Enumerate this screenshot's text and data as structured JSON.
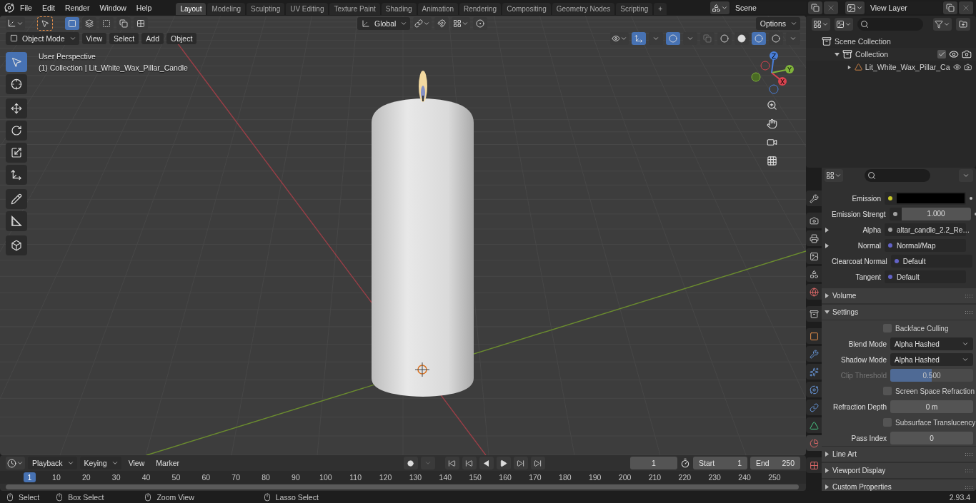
{
  "menu": [
    "File",
    "Edit",
    "Render",
    "Window",
    "Help"
  ],
  "workspaces": [
    {
      "label": "Layout",
      "selected": true
    },
    {
      "label": "Modeling",
      "selected": false
    },
    {
      "label": "Sculpting",
      "selected": false
    },
    {
      "label": "UV Editing",
      "selected": false
    },
    {
      "label": "Texture Paint",
      "selected": false
    },
    {
      "label": "Shading",
      "selected": false
    },
    {
      "label": "Animation",
      "selected": false
    },
    {
      "label": "Rendering",
      "selected": false
    },
    {
      "label": "Compositing",
      "selected": false
    },
    {
      "label": "Geometry Nodes",
      "selected": false
    },
    {
      "label": "Scripting",
      "selected": false
    }
  ],
  "add_workspace": "+",
  "scene": "Scene",
  "view_layer": "View Layer",
  "tool_header": {
    "select_modes": [
      {
        "selected": true
      },
      {
        "selected": false
      },
      {
        "selected": false
      },
      {
        "selected": false
      },
      {
        "selected": false
      }
    ],
    "orientation": "Global",
    "options": "Options"
  },
  "viewport_header": {
    "mode": "Object Mode",
    "menus": [
      "View",
      "Select",
      "Add",
      "Object"
    ],
    "shading": [
      {
        "selected": false
      },
      {
        "selected": false
      },
      {
        "selected": true
      },
      {
        "selected": false
      }
    ]
  },
  "toolbar": [
    {
      "kind": "select",
      "selected": true
    },
    {
      "kind": "cursor",
      "selected": false
    },
    {
      "kind": "move",
      "selected": false
    },
    {
      "kind": "rotate",
      "selected": false
    },
    {
      "kind": "scale",
      "selected": false
    },
    {
      "kind": "transform",
      "selected": false
    },
    {
      "kind": "annotate",
      "selected": false
    },
    {
      "kind": "measure",
      "selected": false
    },
    {
      "kind": "add_cube",
      "selected": false
    }
  ],
  "viewport": {
    "view_name": "User Perspective",
    "collection_info": "(1) Collection | Lit_White_Wax_Pillar_Candle",
    "gizmo_axes": [
      "X",
      "Y",
      "Z"
    ]
  },
  "outliner": {
    "items": [
      {
        "label": "Scene Collection",
        "kind": "scene",
        "children": [
          {
            "label": "Collection",
            "kind": "collection",
            "expanded": true,
            "checked": true,
            "children": [
              {
                "label": "Lit_White_Wax_Pillar_Ca",
                "kind": "object",
                "expanded": false
              }
            ]
          }
        ]
      }
    ]
  },
  "properties": {
    "tabs": [
      {
        "kind": "tool",
        "selected": false
      },
      {
        "kind": "render",
        "selected": false
      },
      {
        "kind": "output",
        "selected": false
      },
      {
        "kind": "view_layer",
        "selected": false
      },
      {
        "kind": "scene",
        "selected": false
      },
      {
        "kind": "world",
        "selected": false
      },
      {
        "kind": "collection",
        "selected": false
      },
      {
        "kind": "object",
        "selected": false
      },
      {
        "kind": "modifier",
        "selected": false
      },
      {
        "kind": "particles",
        "selected": false
      },
      {
        "kind": "physics",
        "selected": false
      },
      {
        "kind": "constraints",
        "selected": false
      },
      {
        "kind": "data",
        "selected": false
      },
      {
        "kind": "material",
        "selected": true
      },
      {
        "kind": "texture",
        "selected": false
      }
    ],
    "sockets": [
      {
        "kind": "color",
        "label": "Emission",
        "color": "#c7c729",
        "expandable": false,
        "keyframe_dot": true
      },
      {
        "kind": "number",
        "label": "Emission Strengt",
        "value": "1.000",
        "color": "#a1a1a1",
        "expandable": false,
        "keyframe_dot": true
      },
      {
        "kind": "link",
        "label": "Alpha",
        "value": "altar_candle_2.2_Re…",
        "color": "#a1a1a1",
        "expandable": true,
        "keyframe_dot": false
      },
      {
        "kind": "link",
        "label": "Normal",
        "value": "Normal/Map",
        "color": "#6363c7",
        "expandable": true,
        "keyframe_dot": false
      },
      {
        "kind": "link",
        "label": "Clearcoat Normal",
        "value": "Default",
        "color": "#6363c7",
        "expandable": false,
        "keyframe_dot": false
      },
      {
        "kind": "link",
        "label": "Tangent",
        "value": "Default",
        "color": "#6363c7",
        "expandable": false,
        "keyframe_dot": false
      }
    ],
    "panels_before": [
      {
        "label": "Volume",
        "expanded": false
      }
    ],
    "settings": {
      "label": "Settings",
      "expanded": true,
      "rows": [
        {
          "kind": "checkbox",
          "label": "Backface Culling",
          "checked": false
        },
        {
          "kind": "dropdown",
          "label": "Blend Mode",
          "value": "Alpha Hashed"
        },
        {
          "kind": "dropdown",
          "label": "Shadow Mode",
          "value": "Alpha Hashed"
        },
        {
          "kind": "slider",
          "label": "Clip Threshold",
          "value": "0.500",
          "level": 0.5,
          "disabled": true
        },
        {
          "kind": "checkbox",
          "label": "Screen Space Refraction",
          "checked": false
        },
        {
          "kind": "number",
          "label": "Refraction Depth",
          "value": "0 m"
        },
        {
          "kind": "checkbox",
          "label": "Subsurface Translucency",
          "checked": false
        },
        {
          "kind": "number",
          "label": "Pass Index",
          "value": "0"
        }
      ]
    },
    "panels_after": [
      {
        "label": "Line Art",
        "expanded": false
      },
      {
        "label": "Viewport Display",
        "expanded": false
      },
      {
        "label": "Custom Properties",
        "expanded": false
      }
    ]
  },
  "timeline": {
    "menus": [
      "Playback",
      "Keying",
      "View",
      "Marker"
    ],
    "current_frame": "1",
    "start_label": "Start",
    "start": "1",
    "end_label": "End",
    "end": "250",
    "ruler_current": "1",
    "ticks": [
      "10",
      "20",
      "30",
      "40",
      "50",
      "60",
      "70",
      "80",
      "90",
      "100",
      "110",
      "120",
      "130",
      "140",
      "150",
      "160",
      "170",
      "180",
      "190",
      "200",
      "210",
      "220",
      "230",
      "240",
      "250"
    ]
  },
  "status_bar": {
    "hints": [
      "Select",
      "Box Select",
      "Zoom View",
      "Lasso Select"
    ],
    "version": "2.93.4"
  }
}
